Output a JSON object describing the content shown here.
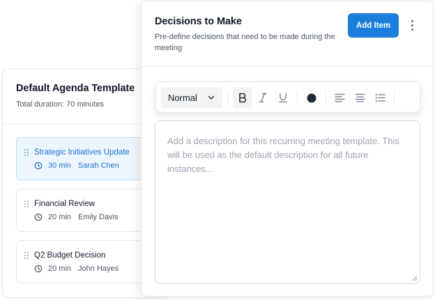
{
  "agenda": {
    "title": "Default Agenda Template",
    "subtitle": "Total duration: 70 minutes",
    "items": [
      {
        "title": "Strategic Initiatives Update",
        "duration": "30 min",
        "owner": "Sarah Chen",
        "active": true
      },
      {
        "title": "Financial Review",
        "duration": "20 min",
        "owner": "Emily Davis",
        "active": false
      },
      {
        "title": "Q2 Budget Decision",
        "duration": "20 min",
        "owner": "John Hayes",
        "active": false
      }
    ]
  },
  "decisions": {
    "title": "Decisions to Make",
    "subtitle": "Pre-define decisions that need to be made during the meeting",
    "add_label": "Add Item",
    "more_icon": "more-vertical-icon"
  },
  "toolbar": {
    "style_select": "Normal",
    "icons": [
      "bold-icon",
      "italic-icon",
      "underline-icon",
      "text-color-icon",
      "align-left-icon",
      "align-center-icon",
      "bullet-list-icon"
    ],
    "text_color": "#1f2937"
  },
  "editor": {
    "placeholder": "Add a description for this recurring meeting template. This will be used as the default description for all future instances..."
  },
  "colors": {
    "accent": "#1a7fdc",
    "active_item_bg": "#eef6fd",
    "active_item_text": "#1d73c9"
  }
}
